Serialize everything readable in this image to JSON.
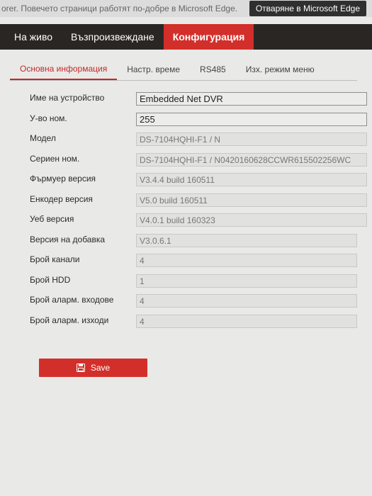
{
  "browser": {
    "message": "orer. Повечето страници работят по-добре в Microsoft Edge.",
    "open_button": "Отваряне в Microsoft Edge"
  },
  "nav": {
    "live": "На живо",
    "playback": "Възпроизвеждане",
    "configuration": "Конфигурация"
  },
  "tabs": {
    "basic_info": "Основна информация",
    "time_settings": "Настр. време",
    "rs485": "RS485",
    "menu_output": "Изх. режим меню"
  },
  "form": {
    "device_name_label": "Име на устройство",
    "device_name_value": "Embedded Net DVR",
    "device_no_label": "У-во ном.",
    "device_no_value": "255",
    "model_label": "Модел",
    "model_value": "DS-7104HQHI-F1 / N",
    "serial_label": "Сериен ном.",
    "serial_value": "DS-7104HQHI-F1 / N0420160628CCWR615502256WC",
    "firmware_label": "Фърмуер версия",
    "firmware_value": "V3.4.4 build 160511",
    "encoder_label": "Енкодер версия",
    "encoder_value": "V5.0 build 160511",
    "web_label": "Уеб версия",
    "web_value": "V4.0.1 build 160323",
    "plugin_label": "Версия на добавка",
    "plugin_value": "V3.0.6.1",
    "channels_label": "Брой канали",
    "channels_value": "4",
    "hdd_label": "Брой HDD",
    "hdd_value": "1",
    "alarm_in_label": "Брой аларм. входове",
    "alarm_in_value": "4",
    "alarm_out_label": "Брой аларм. изходи",
    "alarm_out_value": "4"
  },
  "actions": {
    "save_label": "Save"
  },
  "colors": {
    "accent": "#d32f2a",
    "nav_bg": "#2a2624"
  }
}
